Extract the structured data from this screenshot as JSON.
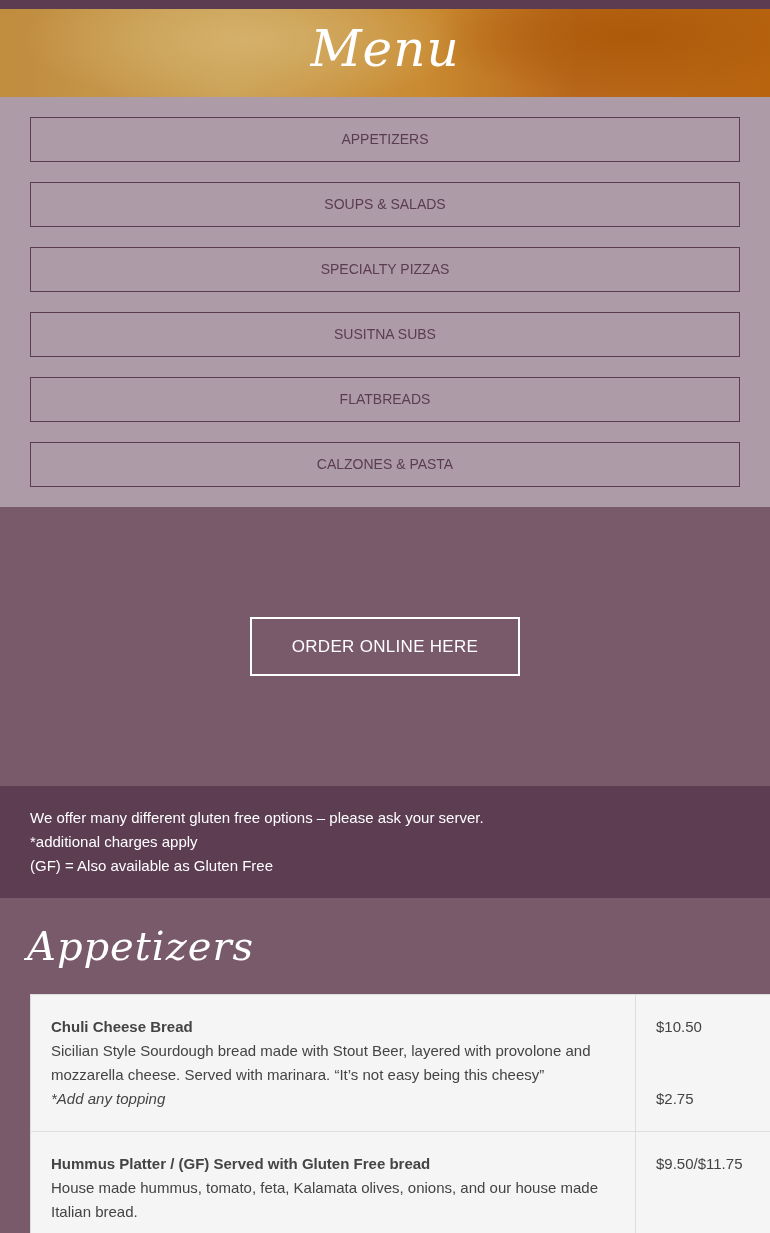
{
  "header": {
    "title": "Menu"
  },
  "category_nav": [
    {
      "label": "APPETIZERS"
    },
    {
      "label": "SOUPS & SALADS"
    },
    {
      "label": "SPECIALTY PIZZAS"
    },
    {
      "label": "SUSITNA SUBS"
    },
    {
      "label": "FLATBREADS"
    },
    {
      "label": "CALZONES & PASTA"
    }
  ],
  "order_button": {
    "label": "ORDER ONLINE HERE"
  },
  "notes": [
    "We offer many different gluten free options – please ask your server.",
    "*additional charges apply",
    "(GF) = Also available as Gluten Free"
  ],
  "section": {
    "title": "Appetizers",
    "items": [
      {
        "name": "Chuli Cheese Bread",
        "description": "Sicilian Style Sourdough bread made with Stout Beer, layered with provolone and mozzarella cheese. Served with marinara. “It’s not easy being this cheesy”",
        "price": "$10.50",
        "extras": [
          {
            "text": "*Add any topping",
            "price": "$2.75"
          }
        ]
      },
      {
        "name": "Hummus Platter / (GF) Served with Gluten Free bread",
        "description": "House made hummus, tomato, feta, Kalamata olives, onions, and our house made Italian bread.",
        "price": "$9.50/$11.75"
      }
    ]
  }
}
